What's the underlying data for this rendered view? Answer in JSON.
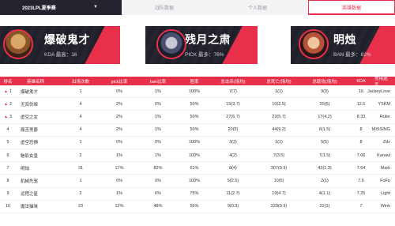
{
  "tabs": {
    "season": "2023LPL夏季赛",
    "season_caret": "▼",
    "tab2": "战队数据",
    "tab3": "个人数据",
    "tab4": "英雄数据"
  },
  "cards": [
    {
      "name": "爆破鬼才",
      "meta_label": "KDA 最高：",
      "meta_value": "16"
    },
    {
      "name": "残月之肃",
      "meta_label": "PICK 最多：",
      "meta_value": "76%"
    },
    {
      "name": "明烛",
      "meta_label": "BAN 最多：",
      "meta_value": "82%"
    }
  ],
  "table": {
    "headers": [
      "排名",
      "英雄名称",
      "出场次数",
      "pick比率",
      "ban比率",
      "胜率",
      "总击杀(场均)",
      "总死亡(场均)",
      "总助攻(场均)",
      "KDA",
      "常用选手"
    ],
    "rows": [
      {
        "rank": "1",
        "icon": "▲",
        "hero": "爆破鬼才",
        "count": "1",
        "pick": "0%",
        "ban": "1%",
        "win": "100%",
        "kills": "7(7)",
        "deaths": "1(1)",
        "assists": "9(9)",
        "kda": "16",
        "player": "JackeyLove"
      },
      {
        "rank": "2",
        "icon": "▲",
        "hero": "无双剑姬",
        "count": "4",
        "pick": "2%",
        "ban": "6%",
        "win": "50%",
        "kills": "15(3.7)",
        "deaths": "10(2.5)",
        "assists": "20(5)",
        "kda": "12.5",
        "player": "YSKM"
      },
      {
        "rank": "3",
        "icon": "▲",
        "hero": "虚空之女",
        "count": "4",
        "pick": "2%",
        "ban": "1%",
        "win": "50%",
        "kills": "27(6.7)",
        "deaths": "23(5.7)",
        "assists": "17(4.2)",
        "kda": "8.33",
        "player": "Ruler"
      },
      {
        "rank": "4",
        "icon": "",
        "hero": "痛苦男爵",
        "count": "4",
        "pick": "2%",
        "ban": "1%",
        "win": "50%",
        "kills": "20(5)",
        "deaths": "44(9.2)",
        "assists": "6(1.5)",
        "kda": "8",
        "player": "MISSING"
      },
      {
        "rank": "5",
        "icon": "",
        "hero": "虚空恐惧",
        "count": "1",
        "pick": "0%",
        "ban": "0%",
        "win": "100%",
        "kills": "3(3)",
        "deaths": "1(1)",
        "assists": "5(5)",
        "kda": "8",
        "player": "Zdz"
      },
      {
        "rank": "6",
        "icon": "",
        "hero": "魅影女皇",
        "count": "2",
        "pick": "1%",
        "ban": "1%",
        "win": "100%",
        "kills": "4(2)",
        "deaths": "7(3.5)",
        "assists": "7(1.5)",
        "kda": "7.66",
        "player": "Kanavi"
      },
      {
        "rank": "7",
        "icon": "",
        "hero": "明烛",
        "count": "31",
        "pick": "17%",
        "ban": "82%",
        "win": "61%",
        "kills": "8(4)",
        "deaths": "307(9.9)",
        "assists": "42(1.3)",
        "kda": "7.64",
        "player": "Mark"
      },
      {
        "rank": "8",
        "icon": "",
        "hero": "机械先驱",
        "count": "1",
        "pick": "0%",
        "ban": "0%",
        "win": "100%",
        "kills": "5(2.5)",
        "deaths": "10(5)",
        "assists": "2(1)",
        "kda": "7.5",
        "player": "FoFo"
      },
      {
        "rank": "9",
        "icon": "",
        "hero": "远程之星",
        "count": "2",
        "pick": "1%",
        "ban": "6%",
        "win": "75%",
        "kills": "11(2.7)",
        "deaths": "19(4.7)",
        "assists": "4(1.1)",
        "kda": "7.25",
        "player": "Light"
      },
      {
        "rank": "10",
        "icon": "",
        "hero": "魔法猫咪",
        "count": "23",
        "pick": "12%",
        "ban": "48%",
        "win": "56%",
        "kills": "9(0.3)",
        "deaths": "229(9.9)",
        "assists": "22(1)",
        "kda": "7",
        "player": "Wink"
      }
    ]
  },
  "colors": {
    "accent": "#e8304a",
    "dark": "#1f2029"
  }
}
